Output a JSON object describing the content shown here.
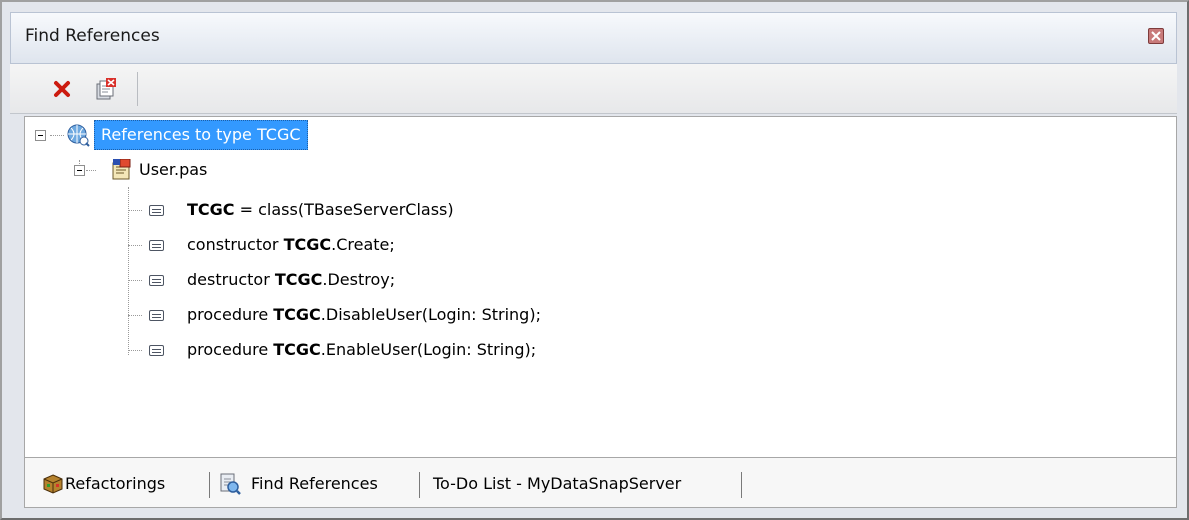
{
  "window": {
    "title": "Find References"
  },
  "toolbar": {
    "icons": [
      "red-x-icon",
      "clear-results-icon"
    ]
  },
  "tree": {
    "root": {
      "label": "References to type TCGC",
      "icon": "references-globe-icon"
    },
    "file": {
      "label": "User.pas",
      "icon": "unit-file-icon"
    },
    "results": [
      {
        "pre": "",
        "bold": "TCGC",
        "post": " = class(TBaseServerClass)"
      },
      {
        "pre": "constructor ",
        "bold": "TCGC",
        "post": ".Create;"
      },
      {
        "pre": "destructor ",
        "bold": "TCGC",
        "post": ".Destroy;"
      },
      {
        "pre": "procedure ",
        "bold": "TCGC",
        "post": ".DisableUser(Login: String);"
      },
      {
        "pre": "procedure ",
        "bold": "TCGC",
        "post": ".EnableUser(Login: String);"
      }
    ]
  },
  "tabs": [
    {
      "label": "Refactorings",
      "icon": "cube-icon"
    },
    {
      "label": "Find References",
      "icon": "find-references-icon"
    },
    {
      "label": "To-Do List - MyDataSnapServer",
      "icon": ""
    }
  ]
}
